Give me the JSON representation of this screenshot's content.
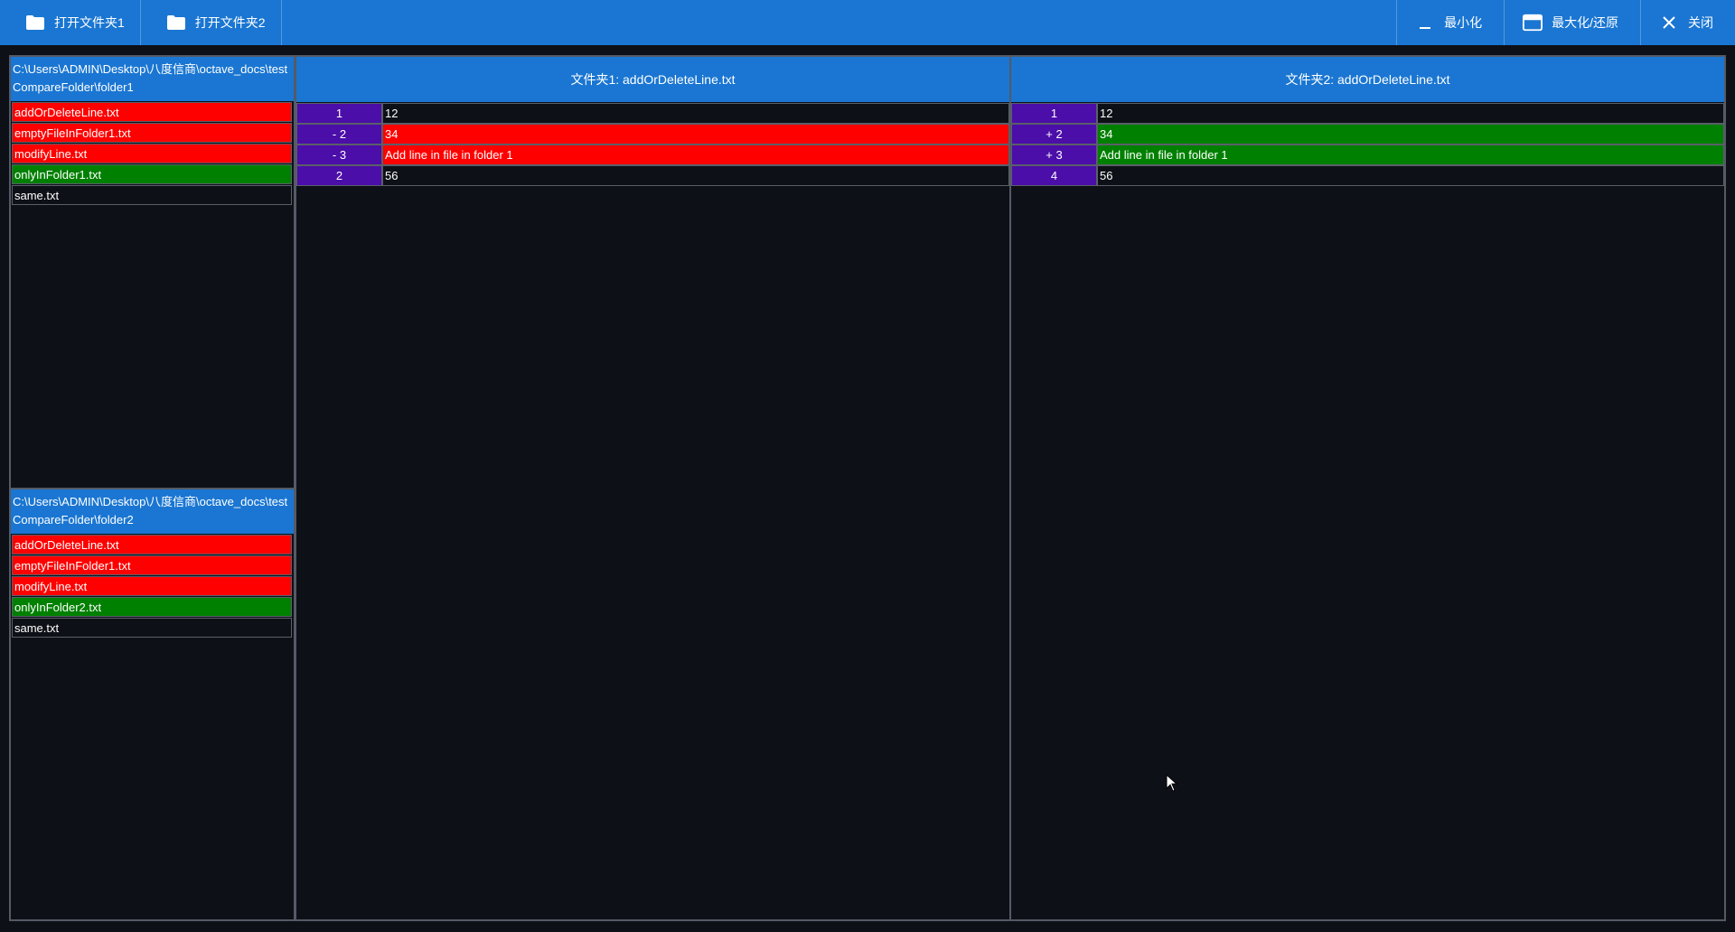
{
  "toolbar": {
    "open_folder1": "打开文件夹1",
    "open_folder2": "打开文件夹2",
    "minimize": "最小化",
    "maximize_restore": "最大化/还原",
    "close": "关闭"
  },
  "folder1": {
    "path": "C:\\Users\\ADMIN\\Desktop\\八度信商\\octave_docs\\testCompareFolder\\folder1",
    "files": [
      {
        "name": "addOrDeleteLine.txt",
        "status": "red"
      },
      {
        "name": "emptyFileInFolder1.txt",
        "status": "red"
      },
      {
        "name": "modifyLine.txt",
        "status": "red"
      },
      {
        "name": "onlyInFolder1.txt",
        "status": "green"
      },
      {
        "name": "same.txt",
        "status": "plain"
      }
    ]
  },
  "folder2": {
    "path": "C:\\Users\\ADMIN\\Desktop\\八度信商\\octave_docs\\testCompareFolder\\folder2",
    "files": [
      {
        "name": "addOrDeleteLine.txt",
        "status": "red"
      },
      {
        "name": "emptyFileInFolder1.txt",
        "status": "red"
      },
      {
        "name": "modifyLine.txt",
        "status": "red"
      },
      {
        "name": "onlyInFolder2.txt",
        "status": "green"
      },
      {
        "name": "same.txt",
        "status": "plain"
      }
    ]
  },
  "diff1": {
    "title": "文件夹1: addOrDeleteLine.txt",
    "rows": [
      {
        "ln": "1",
        "text": "12",
        "status": "plain"
      },
      {
        "ln": "- 2",
        "text": "34",
        "status": "red"
      },
      {
        "ln": "- 3",
        "text": "Add line in file in folder 1",
        "status": "red"
      },
      {
        "ln": "2",
        "text": "56",
        "status": "plain"
      }
    ]
  },
  "diff2": {
    "title": "文件夹2: addOrDeleteLine.txt",
    "rows": [
      {
        "ln": "1",
        "text": "12",
        "status": "plain"
      },
      {
        "ln": "+ 2",
        "text": "34",
        "status": "green"
      },
      {
        "ln": "+ 3",
        "text": "Add line in file in folder 1",
        "status": "green"
      },
      {
        "ln": "4",
        "text": "56",
        "status": "plain"
      }
    ]
  },
  "colors": {
    "accent": "#1a76d2",
    "removed": "#ff0000",
    "added": "#008000",
    "line_number": "#4b0ea8",
    "background": "#0d1016"
  },
  "icons": [
    "folder-icon",
    "folder-icon",
    "minimize-icon",
    "maximize-icon",
    "close-icon",
    "mouse-cursor-icon"
  ]
}
